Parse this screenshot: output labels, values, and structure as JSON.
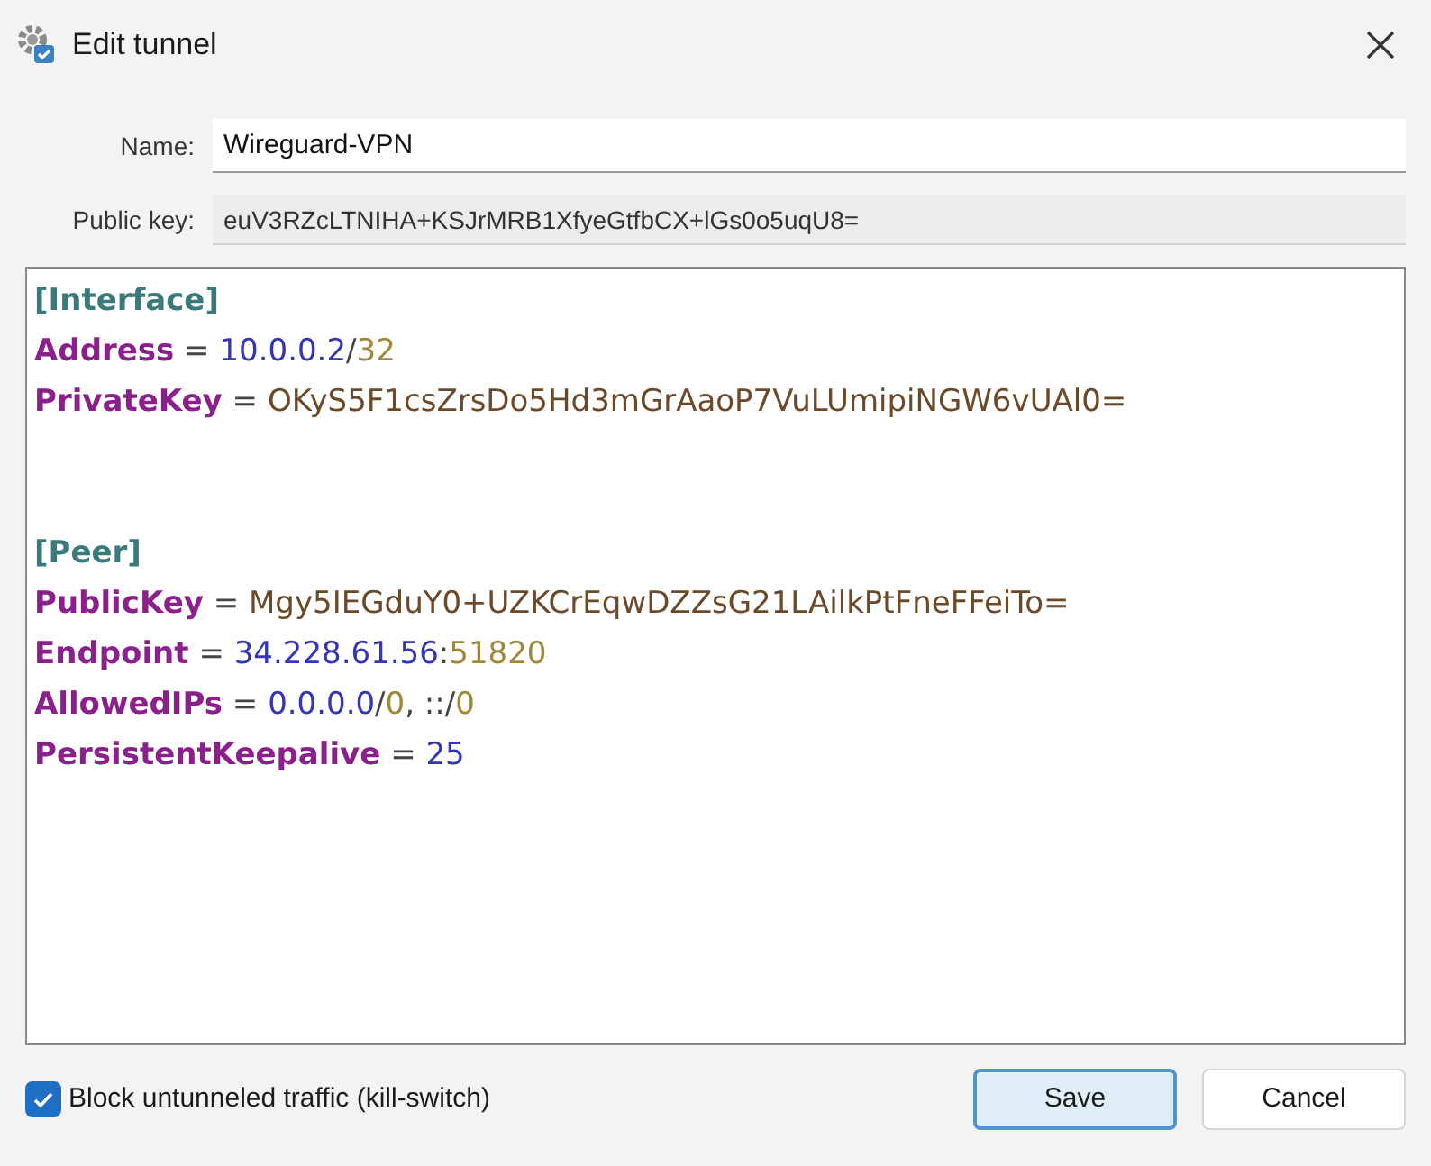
{
  "window": {
    "title": "Edit tunnel"
  },
  "fields": [
    {
      "label": "Name:",
      "value": "Wireguard-VPN",
      "disabled": false
    },
    {
      "label": "Public key:",
      "value": "euV3RZcLTNIHA+KSJrMRB1XfyeGtfbCX+lGs0o5uqU8=",
      "disabled": true
    }
  ],
  "config": {
    "lines": [
      {
        "kind": "text",
        "tokens": [
          {
            "text": "[Interface]",
            "kind": "section"
          }
        ]
      },
      {
        "kind": "text",
        "tokens": [
          {
            "text": "Address",
            "kind": "key"
          },
          {
            "text": " = ",
            "kind": "op"
          },
          {
            "text": "10.0.0.2",
            "kind": "address"
          },
          {
            "text": "/",
            "kind": "op"
          },
          {
            "text": "32",
            "kind": "suffix"
          }
        ]
      },
      {
        "kind": "text",
        "tokens": [
          {
            "text": "PrivateKey",
            "kind": "key"
          },
          {
            "text": " = ",
            "kind": "op"
          },
          {
            "text": "OKyS5F1csZrsDo5Hd3mGrAaoP7VuLUmipiNGW6vUAl0=",
            "kind": "value"
          }
        ]
      },
      {
        "kind": "blank"
      },
      {
        "kind": "blank"
      },
      {
        "kind": "text",
        "tokens": [
          {
            "text": "[Peer]",
            "kind": "section"
          }
        ]
      },
      {
        "kind": "text",
        "tokens": [
          {
            "text": "PublicKey",
            "kind": "key"
          },
          {
            "text": " = ",
            "kind": "op"
          },
          {
            "text": "Mgy5IEGduY0+UZKCrEqwDZZsG21LAilkPtFneFFeiTo=",
            "kind": "value"
          }
        ]
      },
      {
        "kind": "text",
        "tokens": [
          {
            "text": "Endpoint",
            "kind": "key"
          },
          {
            "text": " = ",
            "kind": "op"
          },
          {
            "text": "34.228.61.56",
            "kind": "address"
          },
          {
            "text": ":",
            "kind": "op"
          },
          {
            "text": "51820",
            "kind": "suffix"
          }
        ]
      },
      {
        "kind": "text",
        "tokens": [
          {
            "text": "AllowedIPs",
            "kind": "key"
          },
          {
            "text": " = ",
            "kind": "op"
          },
          {
            "text": "0.0.0.0",
            "kind": "address"
          },
          {
            "text": "/",
            "kind": "op"
          },
          {
            "text": "0",
            "kind": "suffix"
          },
          {
            "text": ", ::",
            "kind": "op"
          },
          {
            "text": "/",
            "kind": "op"
          },
          {
            "text": "0",
            "kind": "suffix"
          }
        ]
      },
      {
        "kind": "text",
        "tokens": [
          {
            "text": "PersistentKeepalive",
            "kind": "key"
          },
          {
            "text": " = ",
            "kind": "op"
          },
          {
            "text": "25",
            "kind": "address"
          }
        ]
      }
    ]
  },
  "kill_switch": {
    "label": "Block untunneled traffic (kill-switch)",
    "checked": true
  },
  "buttons": [
    {
      "label": "Save",
      "focused": true
    },
    {
      "label": "Cancel",
      "focused": false
    }
  ]
}
